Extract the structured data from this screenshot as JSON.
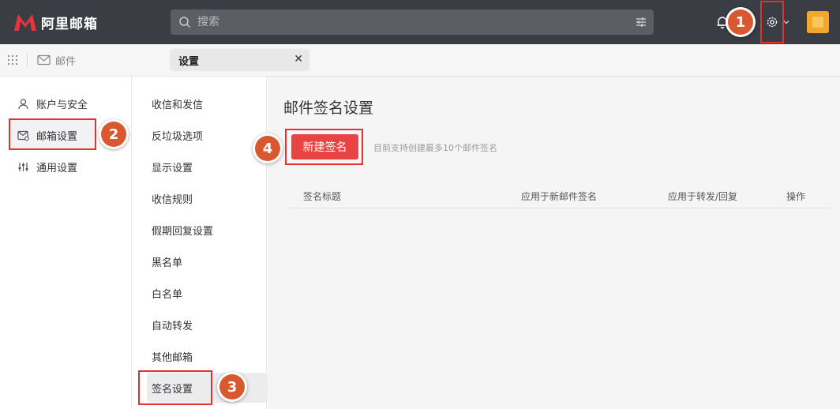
{
  "header": {
    "logo_text": "阿里邮箱",
    "search_placeholder": "搜索",
    "colors": {
      "topbar": "#3a3d44",
      "accent": "#e84444",
      "badge": "#d9582f",
      "highlight_box": "#e5322d"
    }
  },
  "tabs": {
    "mail_label": "邮件",
    "settings_label": "设置",
    "close_glyph": "✕"
  },
  "sidebar": {
    "items": [
      {
        "label": "账户与安全",
        "icon": "user-icon"
      },
      {
        "label": "邮箱设置",
        "icon": "mailbox-settings-icon"
      },
      {
        "label": "通用设置",
        "icon": "sliders-icon"
      }
    ]
  },
  "subnav": {
    "items": [
      "收信和发信",
      "反垃圾选项",
      "显示设置",
      "收信规则",
      "假期回复设置",
      "黑名单",
      "白名单",
      "自动转发",
      "其他邮箱",
      "签名设置"
    ],
    "active": "签名设置"
  },
  "main": {
    "title": "邮件签名设置",
    "new_button": "新建签名",
    "hint": "目前支持创建最多10个邮件签名",
    "columns": [
      "签名标题",
      "应用于新邮件签名",
      "应用于转发/回复",
      "操作"
    ]
  },
  "annotations": [
    "1",
    "2",
    "3",
    "4"
  ]
}
